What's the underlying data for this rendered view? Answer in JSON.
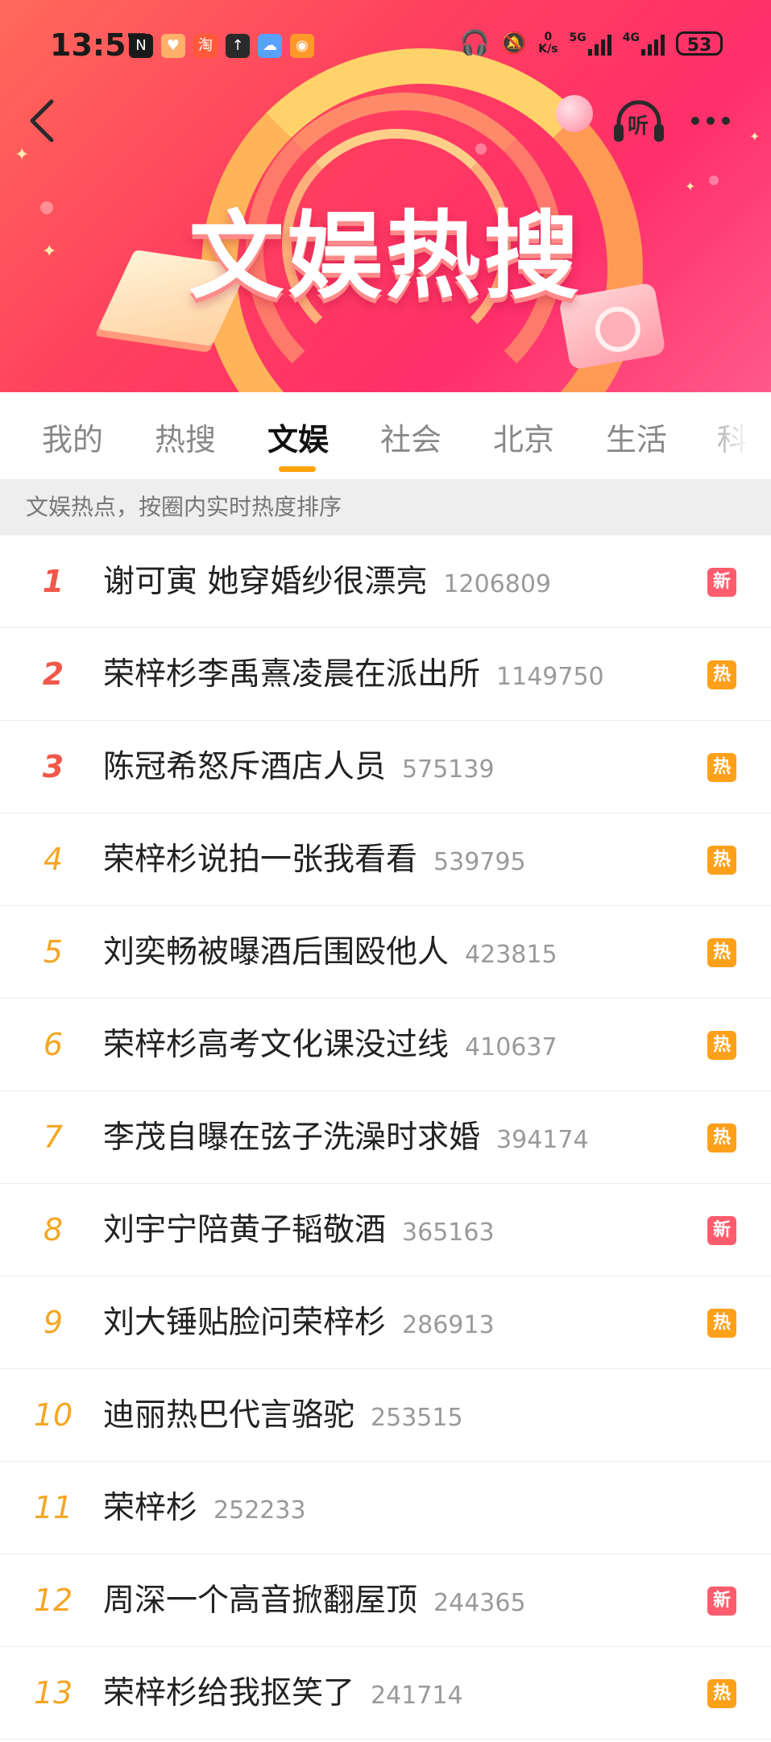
{
  "status_bar": {
    "time": "13:57",
    "net_speed_top": "0",
    "net_speed_unit": "K/s",
    "sig1": "5G",
    "sig2": "4G",
    "battery": "53"
  },
  "header": {
    "banner_title": "文娱热搜",
    "listen_label": "听"
  },
  "tabs": [
    {
      "label": "我的"
    },
    {
      "label": "热搜"
    },
    {
      "label": "文娱"
    },
    {
      "label": "社会"
    },
    {
      "label": "北京"
    },
    {
      "label": "生活"
    },
    {
      "label": "科技"
    }
  ],
  "active_tab": "文娱",
  "subtitle": "文娱热点，按圈内实时热度排序",
  "badge_colors": {
    "新": "#ff5d6e",
    "热": "#ffa01a"
  },
  "list": [
    {
      "rank": "1",
      "title": "谢可寅 她穿婚纱很漂亮",
      "count": "1206809",
      "badge": "新"
    },
    {
      "rank": "2",
      "title": "荣梓杉李禹熹凌晨在派出所",
      "count": "1149750",
      "badge": "热"
    },
    {
      "rank": "3",
      "title": "陈冠希怒斥酒店人员",
      "count": "575139",
      "badge": "热"
    },
    {
      "rank": "4",
      "title": "荣梓杉说拍一张我看看",
      "count": "539795",
      "badge": "热"
    },
    {
      "rank": "5",
      "title": "刘奕畅被曝酒后围殴他人",
      "count": "423815",
      "badge": "热"
    },
    {
      "rank": "6",
      "title": "荣梓杉高考文化课没过线",
      "count": "410637",
      "badge": "热"
    },
    {
      "rank": "7",
      "title": "李茂自曝在弦子洗澡时求婚",
      "count": "394174",
      "badge": "热"
    },
    {
      "rank": "8",
      "title": "刘宇宁陪黄子韬敬酒",
      "count": "365163",
      "badge": "新"
    },
    {
      "rank": "9",
      "title": "刘大锤贴脸问荣梓杉",
      "count": "286913",
      "badge": "热"
    },
    {
      "rank": "10",
      "title": "迪丽热巴代言骆驼",
      "count": "253515",
      "badge": ""
    },
    {
      "rank": "11",
      "title": "荣梓杉",
      "count": "252233",
      "badge": ""
    },
    {
      "rank": "12",
      "title": "周深一个高音掀翻屋顶",
      "count": "244365",
      "badge": "新"
    },
    {
      "rank": "13",
      "title": "荣梓杉给我抠笑了",
      "count": "241714",
      "badge": "热"
    }
  ]
}
